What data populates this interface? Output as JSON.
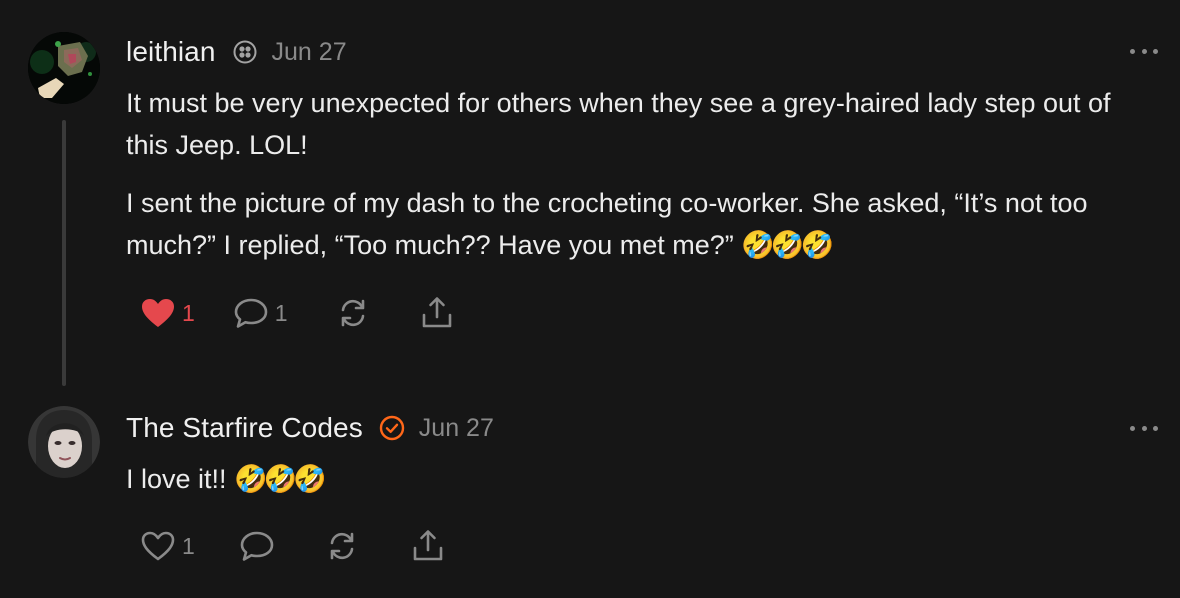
{
  "comments": [
    {
      "author": "leithian",
      "date": "Jun 27",
      "paragraphs": [
        "It must be very unexpected for others when they see a grey-haired lady step out of this Jeep. LOL!",
        "I sent the picture of my dash to the crocheting co-worker. She asked, “It’s not too much?” I replied, “Too much?? Have you met me?”"
      ],
      "emoji": "🤣🤣🤣",
      "likes": "1",
      "liked": true,
      "replies": "1",
      "badge_icon": "substack-flower-badge-icon"
    },
    {
      "author": "The Starfire Codes",
      "date": "Jun 27",
      "paragraphs": [
        "I love it!!"
      ],
      "emoji": "🤣🤣🤣",
      "likes": "1",
      "liked": false,
      "replies": "",
      "badge_icon": "verified-check-badge-icon"
    }
  ],
  "colors": {
    "background": "#161616",
    "liked_heart": "#e5484d",
    "verified_badge": "#ff6719",
    "muted": "#8a8a8a"
  }
}
